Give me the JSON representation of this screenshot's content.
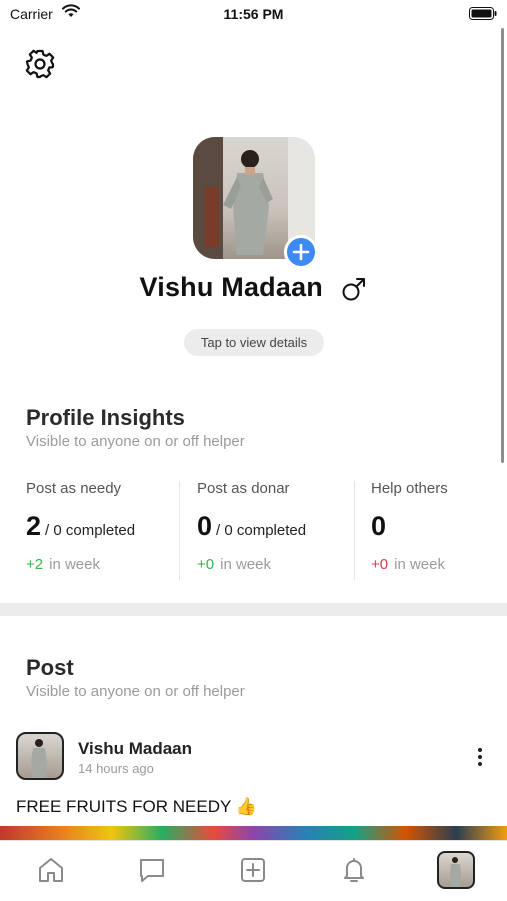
{
  "status_bar": {
    "carrier": "Carrier",
    "time": "11:56 PM"
  },
  "profile": {
    "name": "Vishu Madaan",
    "tap_details": "Tap to view details"
  },
  "insights": {
    "title": "Profile Insights",
    "subtitle": "Visible to anyone on or off helper",
    "stats": [
      {
        "label": "Post as needy",
        "value": "2",
        "suffix": "/ 0 completed",
        "delta": "+2",
        "period": "in week",
        "trend": "up"
      },
      {
        "label": "Post as donar",
        "value": "0",
        "suffix": "/ 0 completed",
        "delta": "+0",
        "period": "in week",
        "trend": "up"
      },
      {
        "label": "Help others",
        "value": "0",
        "suffix": "",
        "delta": "+0",
        "period": "in week",
        "trend": "down"
      }
    ]
  },
  "posts_section": {
    "title": "Post",
    "subtitle": "Visible to anyone on or off helper"
  },
  "post": {
    "author": "Vishu Madaan",
    "time_ago": "14 hours ago",
    "caption": "FREE FRUITS FOR NEEDY 👍"
  },
  "colors": {
    "accent": "#3d8bf2",
    "positive": "#37b34a",
    "negative": "#e5384f"
  },
  "tabbar_icons": [
    "home-icon",
    "chat-icon",
    "add-post-icon",
    "bell-icon",
    "profile-avatar"
  ]
}
